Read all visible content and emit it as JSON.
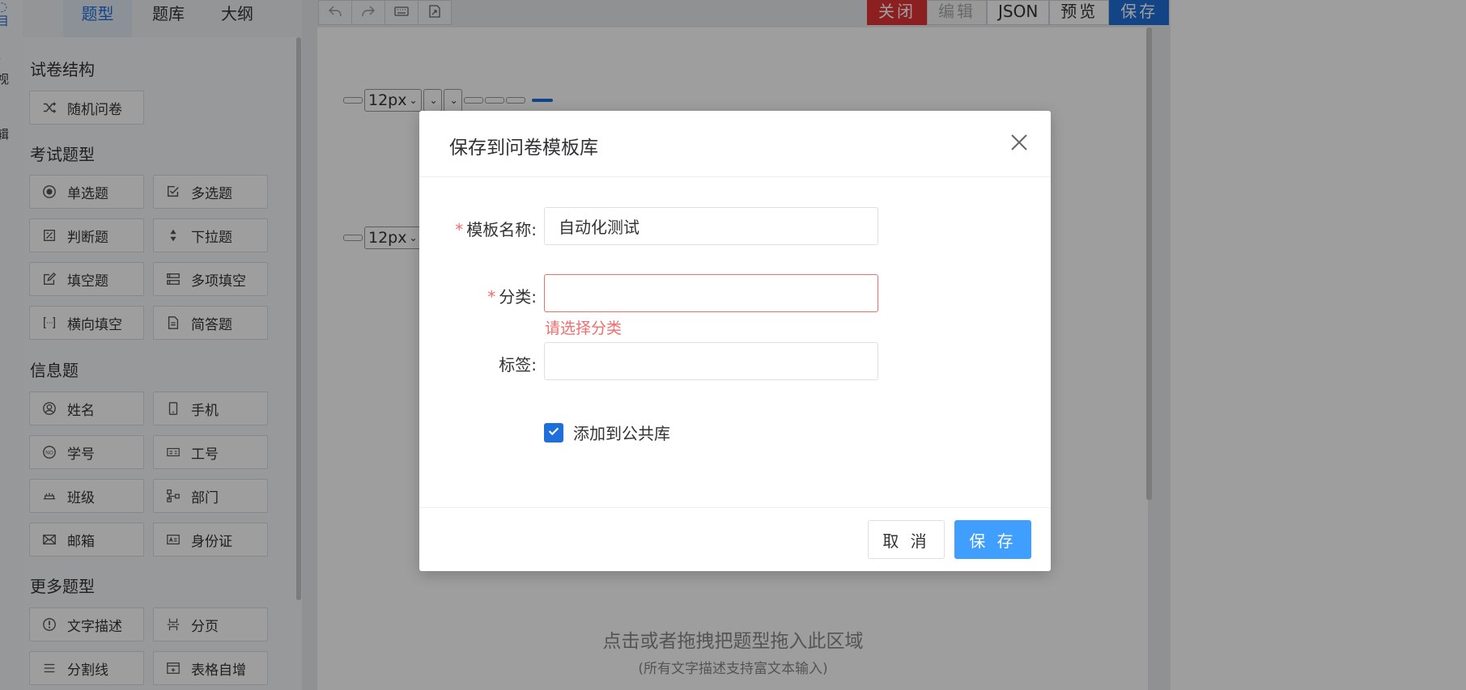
{
  "left_rail": {
    "items": [
      {
        "label": "目",
        "active": true
      },
      {
        "label": "视",
        "active": false
      },
      {
        "label": "辑",
        "active": false
      }
    ]
  },
  "tabs": [
    "题型",
    "题库",
    "大纲"
  ],
  "sections": {
    "structure": {
      "title": "试卷结构",
      "items": [
        {
          "label": "随机问卷",
          "icon": "shuffle-icon"
        }
      ]
    },
    "exam": {
      "title": "考试题型",
      "items": [
        {
          "label": "单选题",
          "icon": "radio-icon"
        },
        {
          "label": "多选题",
          "icon": "checkbox-icon"
        },
        {
          "label": "判断题",
          "icon": "judge-icon"
        },
        {
          "label": "下拉题",
          "icon": "sort-arrows-icon"
        },
        {
          "label": "填空题",
          "icon": "edit-icon"
        },
        {
          "label": "多项填空",
          "icon": "multi-field-icon"
        },
        {
          "label": "横向填空",
          "icon": "bracket-icon"
        },
        {
          "label": "简答题",
          "icon": "document-icon"
        }
      ]
    },
    "info": {
      "title": "信息题",
      "items": [
        {
          "label": "姓名",
          "icon": "user-icon"
        },
        {
          "label": "手机",
          "icon": "mobile-icon"
        },
        {
          "label": "学号",
          "icon": "no-icon"
        },
        {
          "label": "工号",
          "icon": "badge-icon"
        },
        {
          "label": "班级",
          "icon": "class-icon"
        },
        {
          "label": "部门",
          "icon": "org-icon"
        },
        {
          "label": "邮箱",
          "icon": "mail-icon"
        },
        {
          "label": "身份证",
          "icon": "id-card-icon"
        }
      ]
    },
    "more": {
      "title": "更多题型",
      "items": [
        {
          "label": "文字描述",
          "icon": "info-icon"
        },
        {
          "label": "分页",
          "icon": "page-break-icon"
        },
        {
          "label": "分割线",
          "icon": "divider-icon"
        },
        {
          "label": "表格自增",
          "icon": "table-add-icon"
        }
      ]
    }
  },
  "toolbar": {
    "buttons": [
      "undo-icon",
      "redo-icon",
      "keyboard-icon",
      "export-icon"
    ]
  },
  "actions": {
    "close": "关闭",
    "edit": "编辑",
    "json": "JSON",
    "preview": "预览",
    "save": "保存"
  },
  "canvas": {
    "font_size_1": "12px",
    "font_size_2": "12px",
    "drop_hint": "点击或者拖拽把题型拖入此区域",
    "drop_sub": "(所有文字描述支持富文本输入)"
  },
  "modal": {
    "title": "保存到问卷模板库",
    "name_label": "模板名称:",
    "name_value": "自动化测试",
    "category_label": "分类:",
    "category_value": "",
    "category_error": "请选择分类",
    "tag_label": "标签:",
    "tag_value": "",
    "checkbox_label": "添加到公共库",
    "checkbox_checked": true,
    "cancel": "取 消",
    "save": "保 存"
  },
  "colors": {
    "primary": "#409eff",
    "brand_blue": "#1e6fd9",
    "danger": "#f56c6c",
    "close_red": "#e23434"
  }
}
